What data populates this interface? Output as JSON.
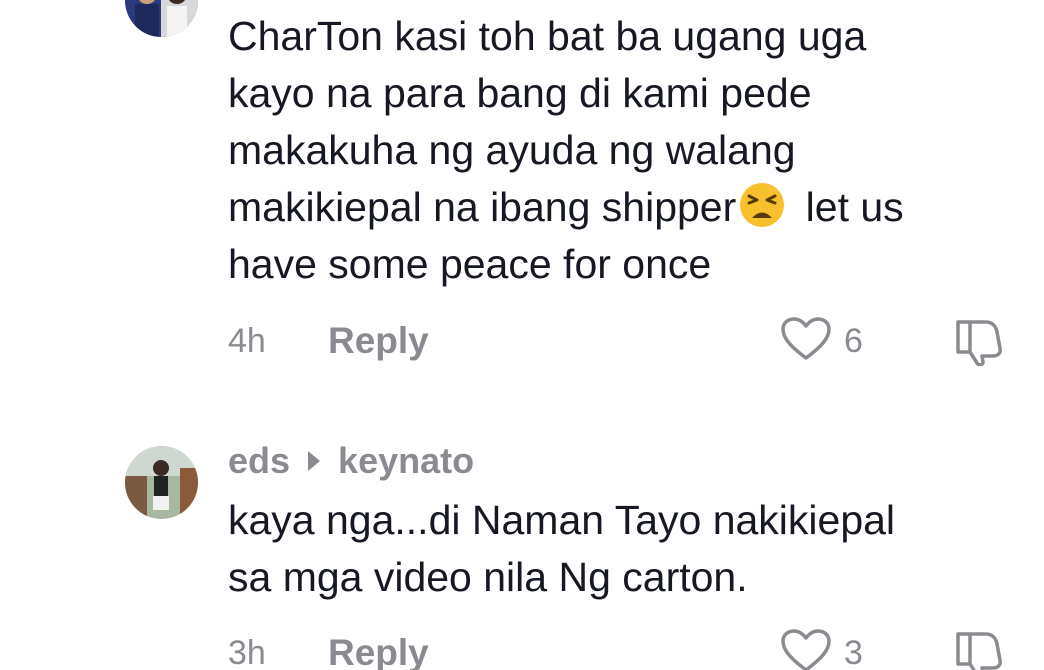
{
  "comments": [
    {
      "text_lines": [
        "CharTon kasi toh bat ba ugang uga",
        "kayo na para bang di kami pede",
        "makakuha ng ayuda ng walang",
        "makikiepal na ibang shipper",
        "have some peace for once"
      ],
      "emoji_after_line_4": "tired-face-emoji",
      "line4_suffix": " let us",
      "time": "4h",
      "reply_label": "Reply",
      "like_count": "6",
      "avatar": "user-avatar-icon"
    },
    {
      "username": "eds",
      "reply_to": "keynato",
      "text_lines": [
        "kaya nga...di Naman Tayo nakikiepal",
        "sa mga video nila Ng carton."
      ],
      "time": "3h",
      "reply_label": "Reply",
      "like_count": "3",
      "avatar": "user-avatar-icon"
    }
  ],
  "colors": {
    "text": "#161823",
    "muted": "#8a8b91",
    "background": "#ffffff"
  }
}
